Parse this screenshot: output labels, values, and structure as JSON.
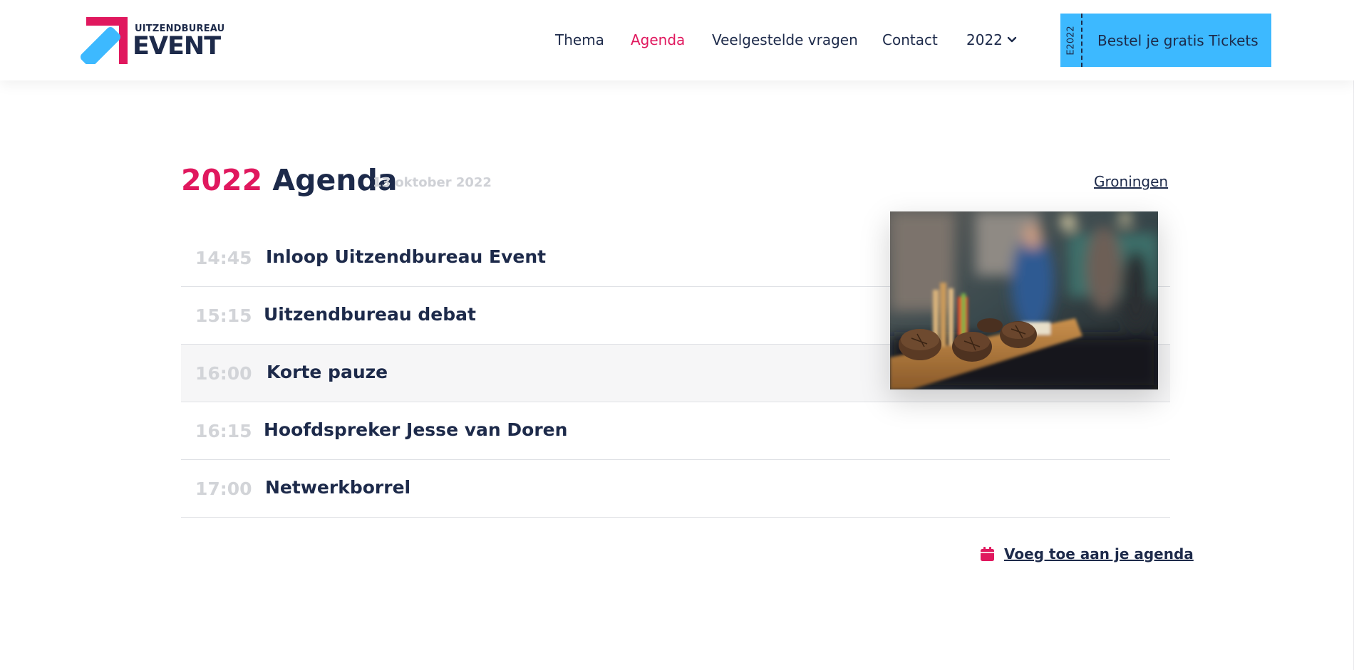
{
  "header": {
    "logo": {
      "top_text": "UITZENDBUREAU",
      "bottom_text": "EVENT",
      "colors": {
        "red": "#e0185e",
        "blue": "#3db9ff",
        "navy": "#1d2a4a"
      }
    },
    "nav": [
      {
        "label": "Thema",
        "active": false
      },
      {
        "label": "Agenda",
        "active": true
      },
      {
        "label": "Veelgestelde vragen",
        "active": false
      },
      {
        "label": "Contact",
        "active": false
      }
    ],
    "year_dropdown": {
      "label": "2022",
      "icon": "chevron-down-icon"
    },
    "ticket_button": {
      "stub_text": "E2022",
      "label": "Bestel je gratis Tickets",
      "color": "#3db9ff"
    }
  },
  "agenda": {
    "year": "2022",
    "title": "Agenda",
    "date": "13 oktober 2022",
    "location": "Groningen",
    "items": [
      {
        "time": "14:45",
        "title": "Inloop Uitzendbureau Event"
      },
      {
        "time": "15:15",
        "title": "Uitzendbureau debat"
      },
      {
        "time": "16:00",
        "title": "Korte pauze"
      },
      {
        "time": "16:15",
        "title": "Hoofdspreker Jesse van Doren"
      },
      {
        "time": "17:00",
        "title": "Netwerkborrel"
      }
    ],
    "add_to_calendar": {
      "label": "Voeg toe aan je agenda",
      "icon": "calendar-icon"
    }
  },
  "colors": {
    "accent": "#e0185e",
    "text": "#1d2a4a",
    "muted": "#d2d4d8",
    "highlight_row": "#f6f6f7"
  }
}
